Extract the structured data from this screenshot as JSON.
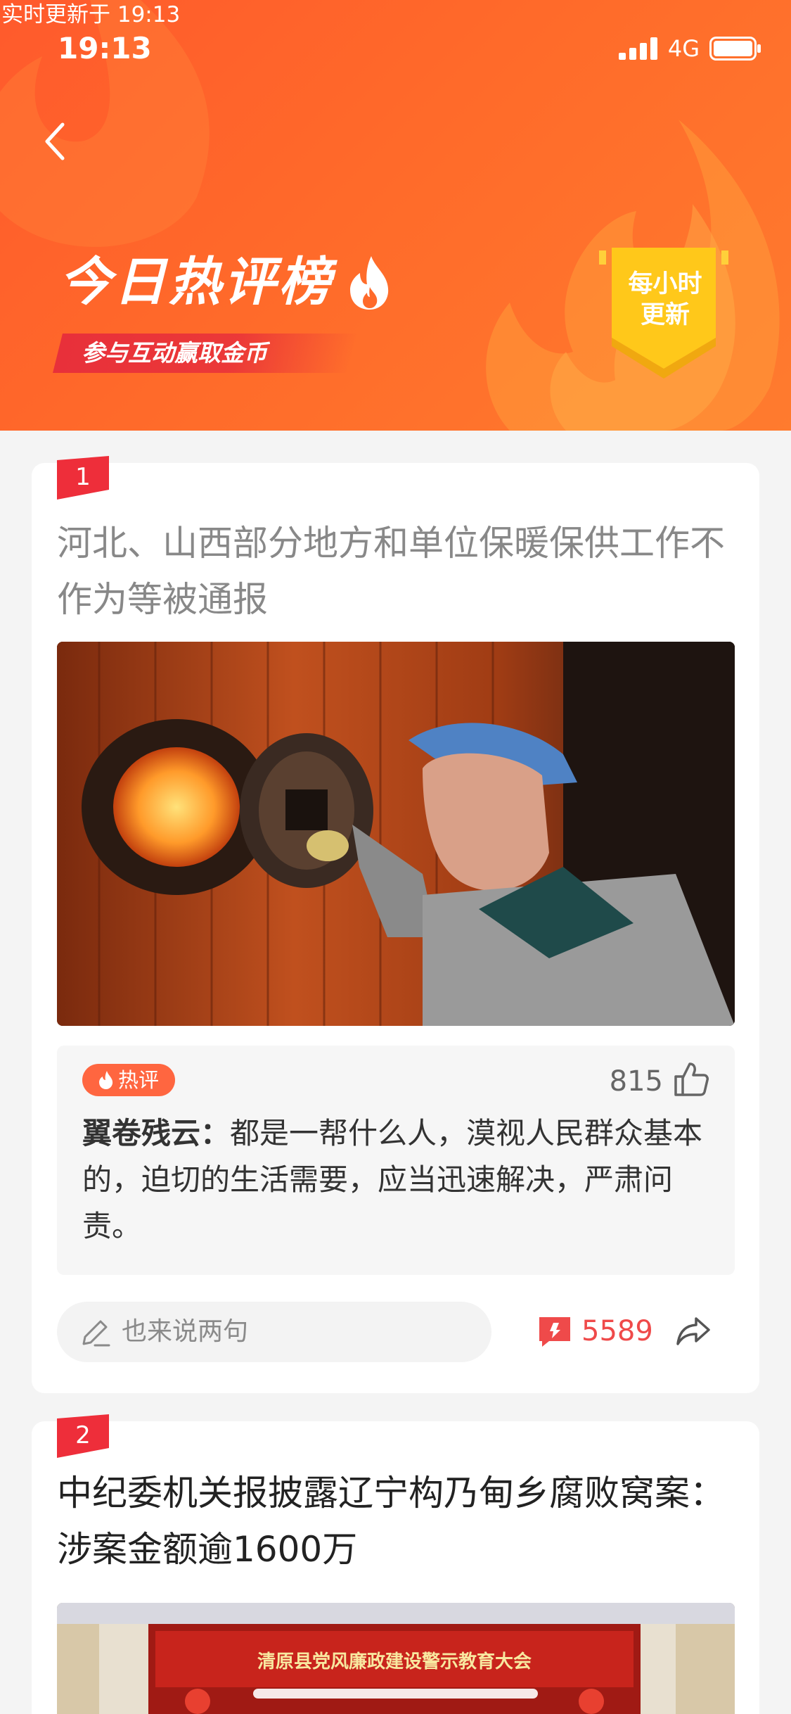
{
  "status_bar": {
    "realtime_label": "实时更新于 19:13",
    "time": "19:13",
    "network": "4G"
  },
  "header": {
    "title": "今日热评榜",
    "subtitle": "参与互动赢取金币",
    "badge_line1": "每小时",
    "badge_line2": "更新"
  },
  "colors": {
    "header_orange": "#ff5a2c",
    "rank_red": "#e8303a",
    "hot_tag": "#ff6640",
    "count_red": "#ef4a4a",
    "badge_yellow": "#ffc81a"
  },
  "articles": [
    {
      "rank": "1",
      "title": "河北、山西部分地方和单位保暖保供工作不作为等被通报",
      "hot_tag": "热评",
      "like_count": "815",
      "comment_author": "翼卷残云：",
      "comment_body": "都是一帮什么人，漠视人民群众基本的，迫切的生活需要，应当迅速解决，严肃问责。",
      "input_placeholder": "也来说两句",
      "comment_count": "5589"
    },
    {
      "rank": "2",
      "title": "中纪委机关报披露辽宁构乃甸乡腐败窝案：涉案金额逾1600万",
      "banner_text": "清原县党风廉政建设警示教育大会"
    }
  ]
}
